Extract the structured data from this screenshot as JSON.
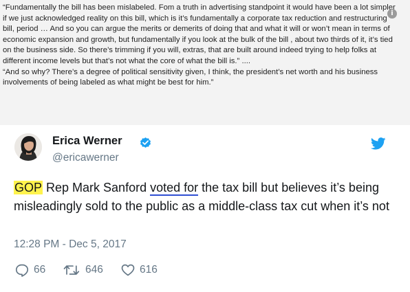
{
  "quote": {
    "paragraph_1": "“Fundamentally the bill has been mislabeled. Fom a truth in advertising standpoint it would have been a lot simpler if we just acknowledged reality on this bill, which is it’s fundamentally a corporate tax reduction and restructuring bill, period … And so you can argue the merits or demerits of doing that and what it will or won’t mean in terms of economic expansion and growth, but fundamentally if you look at the bulk of the bill , about two thirds of it, it’s tied on the business side. So there’s trimming if you will, extras, that are built around indeed trying to help folks at different income levels but that’s not what the core of what the bill is.” ....",
    "paragraph_2": "“And so why? There’s a degree of political sensitivity given, I think, the president’s net worth and his business involvements of being labeled as what might be best for him.”",
    "info_icon": "info-icon"
  },
  "tweet": {
    "author_name": "Erica Werner",
    "author_handle": "@ericawerner",
    "verified_icon": "verified-badge-icon",
    "brand_icon": "twitter-bird-icon",
    "body_part_1": "GOP",
    "body_part_2": " Rep Mark Sanford ",
    "body_part_3": "voted for",
    "body_part_4": " the tax bill but believes it’s being misleadingly sold to the public as a middle-class tax cut when it’s not",
    "timestamp": "12:28 PM - Dec 5, 2017",
    "actions": {
      "replies": "66",
      "retweets": "646",
      "likes": "616"
    },
    "colors": {
      "highlight": "#fff34d",
      "underline": "#2f4fd3",
      "verified": "#1da1f2",
      "twitter_blue": "#1da1f2",
      "muted_text": "#657786"
    }
  }
}
